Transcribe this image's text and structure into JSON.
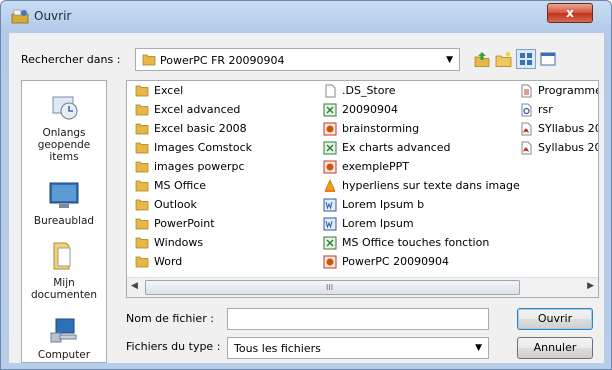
{
  "window": {
    "title": "Ouvrir",
    "close_label": "x"
  },
  "lookin": {
    "label": "Rechercher dans :",
    "value": "PowerPC FR 20090904"
  },
  "toolbar": {
    "icons": [
      "up-folder-icon",
      "new-folder-icon",
      "view-menu-icon",
      "details-view-icon"
    ]
  },
  "places": [
    {
      "label": "Onlangs geopende items",
      "icon": "recent-items-icon"
    },
    {
      "label": "Bureaublad",
      "icon": "desktop-icon"
    },
    {
      "label": "Mijn documenten",
      "icon": "my-documents-icon"
    },
    {
      "label": "Computer",
      "icon": "computer-icon"
    }
  ],
  "files": {
    "col1": [
      {
        "name": "Excel",
        "icon": "folder-icon"
      },
      {
        "name": "Excel advanced",
        "icon": "folder-icon"
      },
      {
        "name": "Excel basic 2008",
        "icon": "folder-icon"
      },
      {
        "name": "Images Comstock",
        "icon": "folder-icon"
      },
      {
        "name": "images powerpc",
        "icon": "folder-icon"
      },
      {
        "name": "MS Office",
        "icon": "folder-icon"
      },
      {
        "name": "Outlook",
        "icon": "folder-icon"
      },
      {
        "name": "PowerPoint",
        "icon": "folder-icon"
      },
      {
        "name": "Windows",
        "icon": "folder-icon"
      },
      {
        "name": "Word",
        "icon": "folder-icon"
      }
    ],
    "col2": [
      {
        "name": ".DS_Store",
        "icon": "blank-file-icon"
      },
      {
        "name": "20090904",
        "icon": "excel-file-icon"
      },
      {
        "name": "brainstorming",
        "icon": "powerpoint-file-icon"
      },
      {
        "name": "Ex charts advanced",
        "icon": "excel-file-icon"
      },
      {
        "name": "exemplePPT",
        "icon": "powerpoint-file-icon"
      },
      {
        "name": "hyperliens sur texte dans image",
        "icon": "vlc-file-icon"
      },
      {
        "name": "Lorem Ipsum b",
        "icon": "word-file-icon"
      },
      {
        "name": "Lorem Ipsum",
        "icon": "word-file-icon"
      },
      {
        "name": "MS Office touches fonction",
        "icon": "excel-file-icon"
      },
      {
        "name": "PowerPC 20090904",
        "icon": "powerpoint-file-icon"
      }
    ],
    "col3": [
      {
        "name": "Programme",
        "icon": "document-file-icon"
      },
      {
        "name": "rsr",
        "icon": "settings-file-icon"
      },
      {
        "name": "SYllabus 20",
        "icon": "pdf-file-icon"
      },
      {
        "name": "Syllabus 20",
        "icon": "pdf-file-icon"
      }
    ]
  },
  "scrollbar": {
    "grip": "III"
  },
  "filename": {
    "label": "Nom de fichier :",
    "value": ""
  },
  "filetype": {
    "label": "Fichiers du type :",
    "value": "Tous les fichiers"
  },
  "buttons": {
    "open": "Ouvrir",
    "cancel": "Annuler"
  },
  "colors": {
    "titlebar": "#c9dcf2",
    "close": "#c1321c",
    "folder": "#e8b746"
  }
}
